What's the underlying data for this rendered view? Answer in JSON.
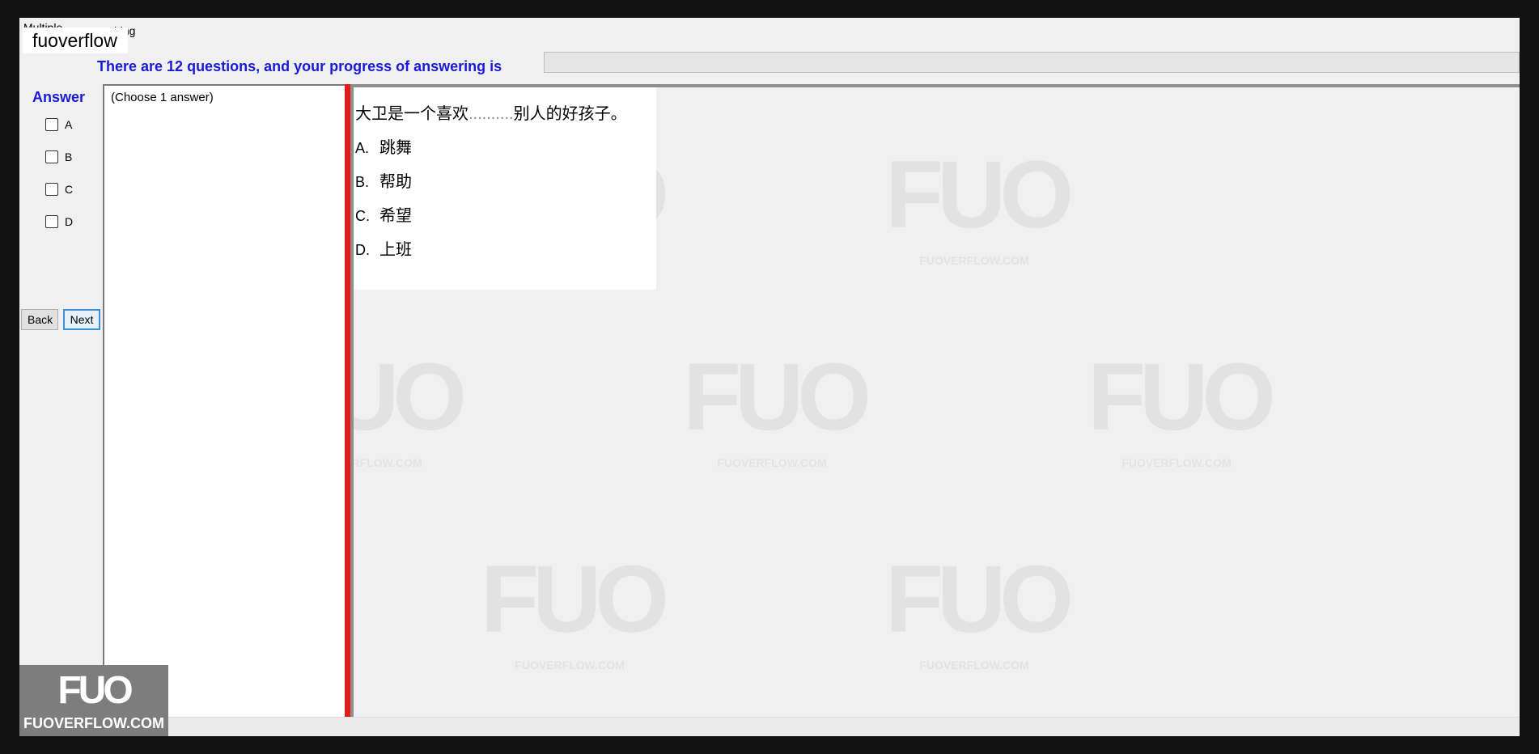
{
  "tabs": {
    "tab1_label": "Multiple Choice",
    "tab2_label": "ching"
  },
  "brand_box": "fuoverflow",
  "progress": {
    "label": "There are 12 questions, and your progress of answering is",
    "fraction": 0.0
  },
  "answer": {
    "title": "Answer",
    "options": [
      "A",
      "B",
      "C",
      "D"
    ]
  },
  "nav": {
    "back_label": "Back",
    "next_label": "Next"
  },
  "choose_hint": "(Choose 1 answer)",
  "question": {
    "text_before": "大卫是一个喜欢",
    "blank": "..........",
    "text_after": "别人的好孩子。",
    "options": [
      {
        "letter": "A.",
        "text": "跳舞"
      },
      {
        "letter": "B.",
        "text": "帮助"
      },
      {
        "letter": "C.",
        "text": "希望"
      },
      {
        "letter": "D.",
        "text": "上班"
      }
    ]
  },
  "watermark": {
    "mark": "FUO",
    "site": "FUOVERFLOW.COM"
  },
  "corner_logo": {
    "mark": "FUO",
    "site": "FUOVERFLOW.COM"
  }
}
